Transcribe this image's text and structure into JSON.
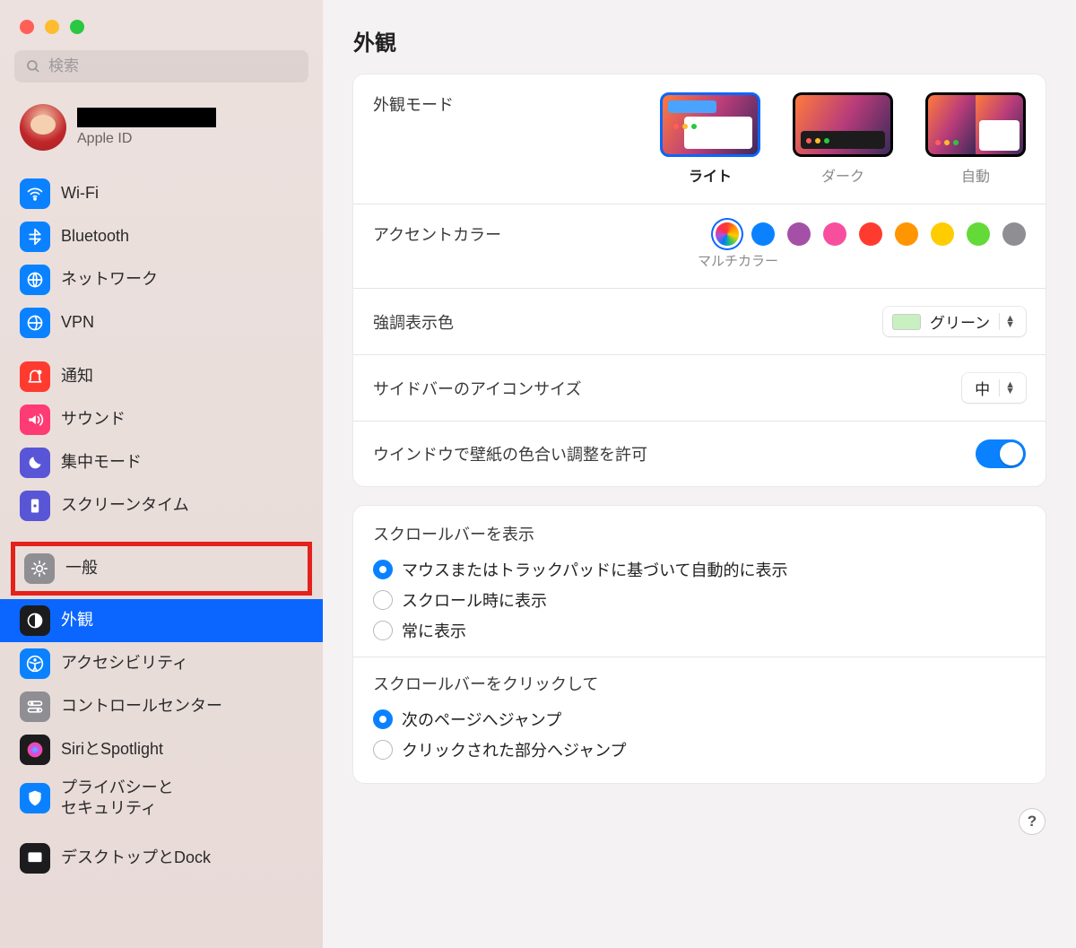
{
  "search": {
    "placeholder": "検索"
  },
  "account": {
    "subtitle": "Apple ID"
  },
  "sidebar": {
    "group1": [
      {
        "label": "Wi-Fi",
        "iconColor": "#0a82ff",
        "iconName": "wifi-icon"
      },
      {
        "label": "Bluetooth",
        "iconColor": "#0a82ff",
        "iconName": "bluetooth-icon"
      },
      {
        "label": "ネットワーク",
        "iconColor": "#0a82ff",
        "iconName": "network-icon"
      },
      {
        "label": "VPN",
        "iconColor": "#0a82ff",
        "iconName": "vpn-icon"
      }
    ],
    "group2": [
      {
        "label": "通知",
        "iconColor": "#ff3b30",
        "iconName": "notifications-icon"
      },
      {
        "label": "サウンド",
        "iconColor": "#ff3b73",
        "iconName": "sound-icon"
      },
      {
        "label": "集中モード",
        "iconColor": "#5856d6",
        "iconName": "focus-icon"
      },
      {
        "label": "スクリーンタイム",
        "iconColor": "#5856d6",
        "iconName": "screentime-icon"
      }
    ],
    "group3": [
      {
        "label": "一般",
        "iconColor": "#8e8e93",
        "iconName": "general-icon",
        "highlight": true
      },
      {
        "label": "外観",
        "iconColor": "#1c1c1e",
        "iconName": "appearance-icon",
        "selected": true
      },
      {
        "label": "アクセシビリティ",
        "iconColor": "#0a82ff",
        "iconName": "accessibility-icon"
      },
      {
        "label": "コントロールセンター",
        "iconColor": "#8e8e93",
        "iconName": "control-center-icon"
      },
      {
        "label": "SiriとSpotlight",
        "iconColor": "#1c1c1e",
        "iconName": "siri-icon"
      },
      {
        "label": "プライバシーと\nセキュリティ",
        "iconColor": "#0a82ff",
        "iconName": "privacy-icon"
      }
    ],
    "group4": [
      {
        "label": "デスクトップとDock",
        "iconColor": "#1c1c1e",
        "iconName": "desktop-dock-icon"
      }
    ]
  },
  "page": {
    "title": "外観"
  },
  "appearance_mode": {
    "label": "外観モード",
    "options": [
      {
        "label": "ライト",
        "selected": true
      },
      {
        "label": "ダーク"
      },
      {
        "label": "自動"
      }
    ]
  },
  "accent_color": {
    "label": "アクセントカラー",
    "sublabel": "マルチカラー",
    "colors": [
      "multicolor",
      "#0a82ff",
      "#a550a7",
      "#f74f9e",
      "#ff3b30",
      "#ff9500",
      "#ffcc00",
      "#63da38",
      "#8e8e93"
    ],
    "selected_index": 0
  },
  "highlight_color": {
    "label": "強調表示色",
    "value": "グリーン",
    "swatch": "#c8f0c0"
  },
  "sidebar_icon_size": {
    "label": "サイドバーのアイコンサイズ",
    "value": "中"
  },
  "wallpaper_tint": {
    "label": "ウインドウで壁紙の色合い調整を許可",
    "enabled": true
  },
  "scrollbars_show": {
    "label": "スクロールバーを表示",
    "options": [
      "マウスまたはトラックパッドに基づいて自動的に表示",
      "スクロール時に表示",
      "常に表示"
    ],
    "selected_index": 0
  },
  "scrollbar_click": {
    "label": "スクロールバーをクリックして",
    "options": [
      "次のページへジャンプ",
      "クリックされた部分へジャンプ"
    ],
    "selected_index": 0
  },
  "help": "?"
}
